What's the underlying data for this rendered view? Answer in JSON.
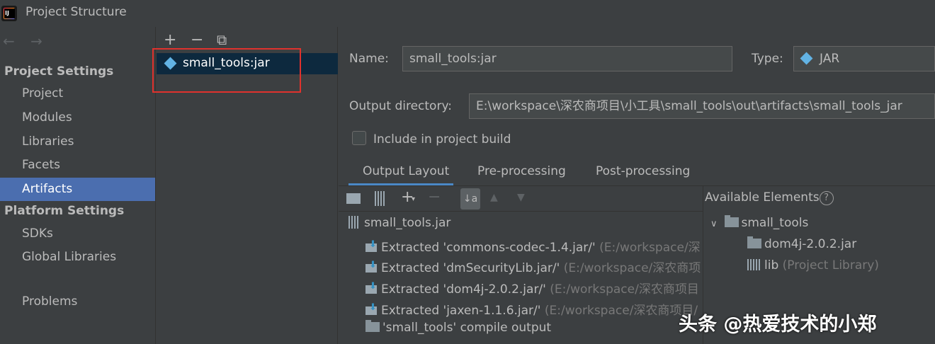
{
  "window": {
    "title": "Project Structure"
  },
  "nav": {
    "back_forward": "← →",
    "project_settings_heading": "Project Settings",
    "project_items": [
      "Project",
      "Modules",
      "Libraries",
      "Facets",
      "Artifacts"
    ],
    "platform_settings_heading": "Platform Settings",
    "platform_items": [
      "SDKs",
      "Global Libraries"
    ],
    "problems": "Problems",
    "selected": "Artifacts"
  },
  "artifact_list": {
    "toolbar": {
      "add": "+",
      "remove": "−",
      "copy": "⧉"
    },
    "items": [
      "small_tools:jar"
    ]
  },
  "detail": {
    "name_label": "Name:",
    "name_value": "small_tools:jar",
    "type_label": "Type:",
    "type_value": "JAR",
    "output_dir_label": "Output directory:",
    "output_dir_value": "E:\\workspace\\深农商项目\\小工具\\small_tools\\out\\artifacts\\small_tools_jar",
    "include_build_label": "Include in project build",
    "include_build_checked": false,
    "tabs": [
      "Output Layout",
      "Pre-processing",
      "Post-processing"
    ],
    "active_tab": "Output Layout"
  },
  "output_layout": {
    "root": "small_tools.jar",
    "entries": [
      {
        "text": "Extracted 'commons-codec-1.4.jar/'",
        "path": "(E:/workspace/深"
      },
      {
        "text": "Extracted 'dmSecurityLib.jar/'",
        "path": "(E:/workspace/深农商项"
      },
      {
        "text": "Extracted 'dom4j-2.0.2.jar/'",
        "path": "(E:/workspace/深农商项目"
      },
      {
        "text": "Extracted 'jaxen-1.1.6.jar/'",
        "path": "(E:/workspace/深农商项目/"
      },
      {
        "text": "'small_tools' compile output",
        "path": ""
      }
    ]
  },
  "available": {
    "heading": "Available Elements",
    "help": "?",
    "root": "small_tools",
    "children": [
      {
        "name": "dom4j-2.0.2.jar",
        "note": ""
      },
      {
        "name": "lib",
        "note": "(Project Library)"
      }
    ]
  },
  "watermark": "头条 @热爱技术的小郑",
  "colors": {
    "selection": "#4b6eaf",
    "tab_underline": "#4a88c7",
    "highlight_box": "#e0322d",
    "jar_icon": "#62b3e4"
  }
}
